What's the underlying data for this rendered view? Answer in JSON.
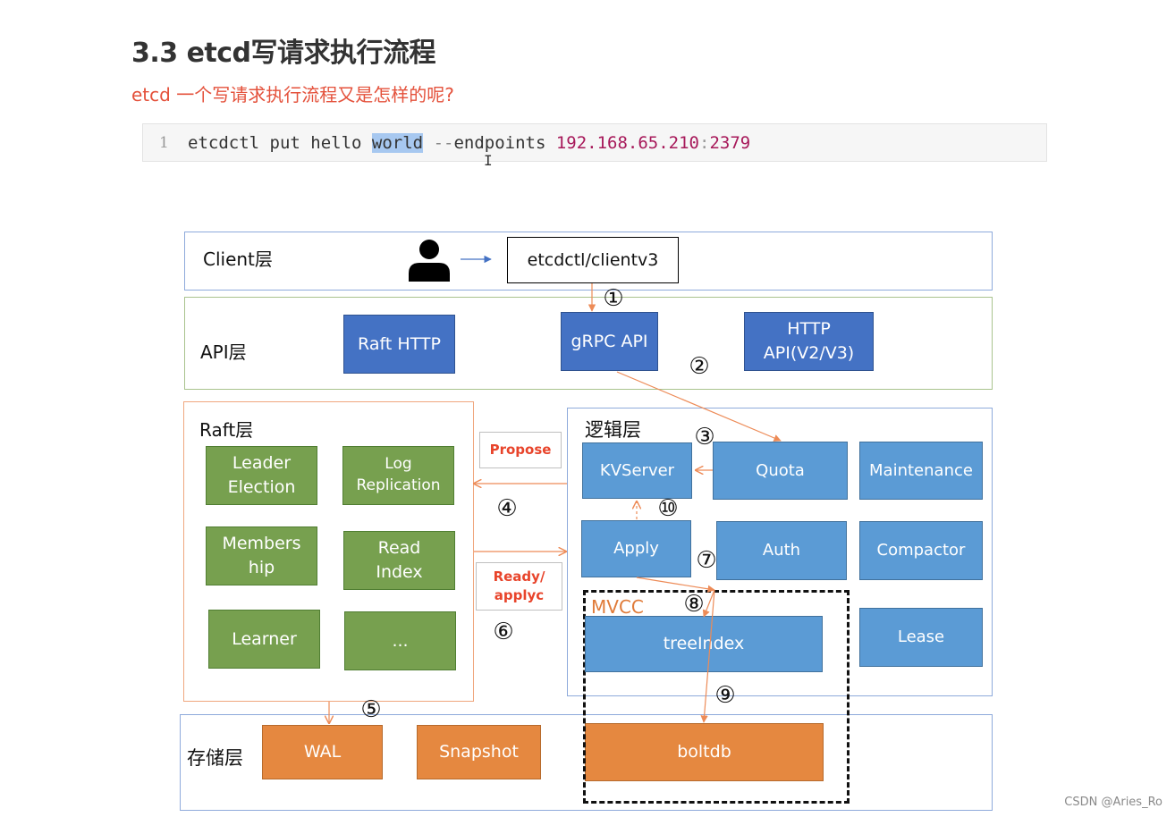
{
  "doc": {
    "heading": "3.3 etcd写请求执行流程",
    "subheading": "etcd 一个写请求执行流程又是怎样的呢?"
  },
  "code": {
    "line_number": "1",
    "tokens": {
      "cmd": "etcdctl put hello ",
      "selected": "world",
      "space": " ",
      "flag_dashes": "--",
      "flag_name": "endpoints ",
      "ip": "192.168.65.210",
      "colon": ":",
      "port": "2379"
    },
    "cursor_glyph": "I"
  },
  "diagram": {
    "client_layer": {
      "label": "Client层",
      "user_icon": "user-icon",
      "client_box": "etcdctl/clientv3"
    },
    "api_layer": {
      "label": "API层",
      "boxes": [
        "Raft HTTP",
        "gRPC API",
        "HTTP\nAPI(V2/V3)"
      ]
    },
    "raft_layer": {
      "label": "Raft层",
      "boxes": [
        "Leader\nElection",
        "Log\nReplication",
        "Members\nhip",
        "Read\nIndex",
        "Learner",
        "..."
      ]
    },
    "messages": {
      "propose": "Propose",
      "ready": "Ready/\napplyc"
    },
    "logic_layer": {
      "label": "逻辑层",
      "boxes": {
        "kvserver": "KVServer",
        "quota": "Quota",
        "maintenance": "Maintenance",
        "apply": "Apply",
        "auth": "Auth",
        "compactor": "Compactor",
        "lease": "Lease"
      }
    },
    "mvcc": {
      "label": "MVCC",
      "tree_index": "treeIndex"
    },
    "storage_layer": {
      "label": "存储层",
      "boxes": [
        "WAL",
        "Snapshot",
        "boltdb"
      ]
    },
    "steps": [
      "①",
      "②",
      "③",
      "④",
      "⑤",
      "⑥",
      "⑦",
      "⑧",
      "⑨",
      "⑩"
    ],
    "colors": {
      "api_box": "#4472c4",
      "logic_box": "#5b9bd5",
      "raft_box": "#77a04f",
      "storage_box": "#e58840",
      "arrow": "#ed8b57",
      "message_text": "#e8442b",
      "mvcc_label": "#e07b39"
    }
  },
  "watermark": "CSDN @Aries_Ro"
}
